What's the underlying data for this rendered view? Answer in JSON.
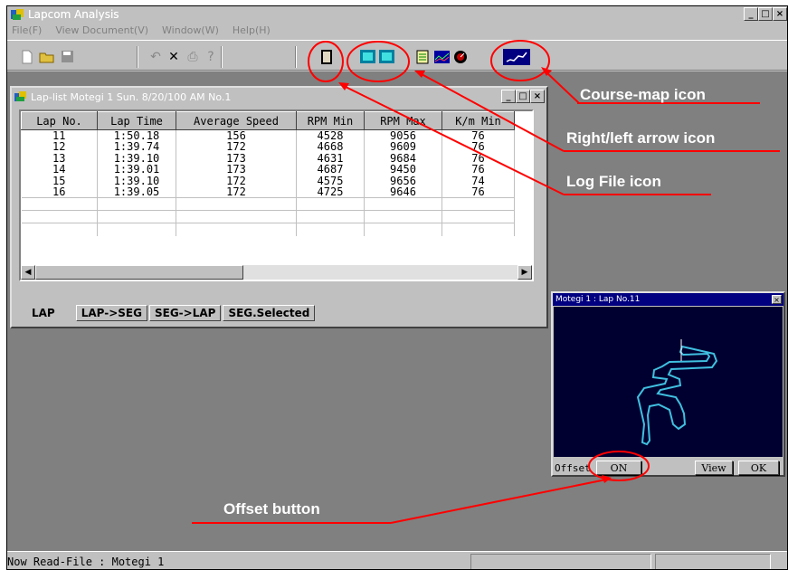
{
  "app": {
    "title": "Lapcom Analysis",
    "minimize": "_",
    "maximize": "□",
    "close": "×"
  },
  "menu": [
    "File(F)",
    "View Document(V)",
    "Window(W)",
    "Help(H)"
  ],
  "child_window": {
    "title": "Lap-list  Motegi 1  Sun. 8/20/100 AM  No.1",
    "columns": [
      "Lap No.",
      "Lap Time",
      "Average Speed",
      "RPM Min",
      "RPM Max",
      "K/m Min"
    ],
    "rows": [
      [
        "11",
        "1:50.18",
        "156",
        "4528",
        "9056",
        "76"
      ],
      [
        "12",
        "1:39.74",
        "172",
        "4668",
        "9609",
        "76"
      ],
      [
        "13",
        "1:39.10",
        "173",
        "4631",
        "9684",
        "76"
      ],
      [
        "14",
        "1:39.01",
        "173",
        "4687",
        "9450",
        "76"
      ],
      [
        "15",
        "1:39.10",
        "172",
        "4575",
        "9656",
        "74"
      ],
      [
        "16",
        "1:39.05",
        "172",
        "4725",
        "9646",
        "76"
      ]
    ],
    "tabs": [
      "LAP",
      "LAP->SEG",
      "SEG->LAP",
      "SEG.Selected"
    ]
  },
  "map_window": {
    "title": "Motegi 1 : Lap No.11",
    "offset_label": "Offset",
    "on_button": "ON",
    "view_button": "View",
    "ok_button": "OK"
  },
  "status_text": "Now Read-File : Motegi 1",
  "callouts": {
    "course_map": "Course-map icon",
    "arrow": "Right/left arrow icon",
    "log_file": "Log File icon",
    "offset": "Offset button"
  },
  "colors": {
    "annotation": "#ff0000",
    "mdi_background": "#808080",
    "map_background": "#000030",
    "track": "#40c0e0"
  }
}
